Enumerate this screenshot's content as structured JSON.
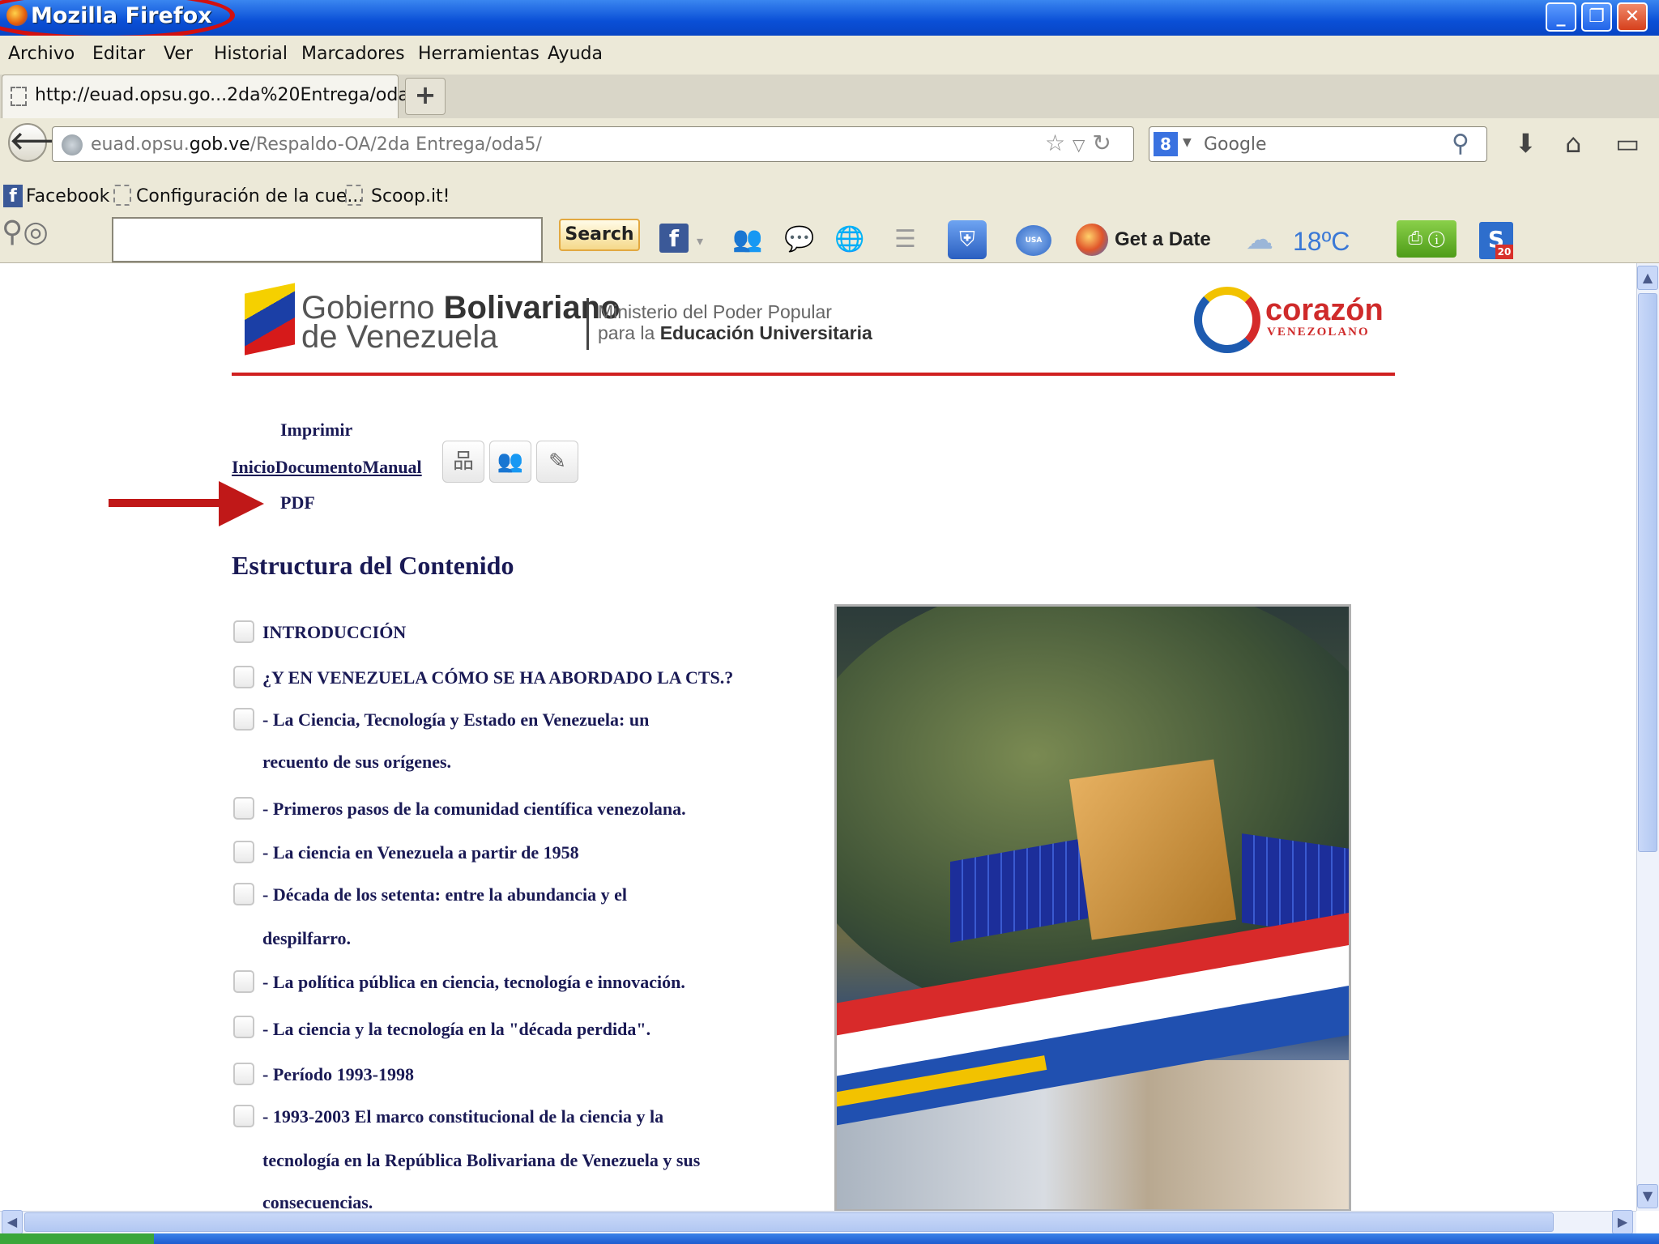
{
  "window": {
    "title": "Mozilla Firefox",
    "controls": {
      "minimize": "_",
      "maximize": "❐",
      "close": "✕"
    }
  },
  "menu": [
    "Archivo",
    "Editar",
    "Ver",
    "Historial",
    "Marcadores",
    "Herramientas",
    "Ayuda"
  ],
  "tab": {
    "label": "http://euad.opsu.go...2da%20Entrega/oda5/",
    "new_tab": "+"
  },
  "navbar": {
    "url_prefix": "euad.opsu.",
    "url_domain": "gob.ve",
    "url_path": "/Respaldo-OA/2da Entrega/oda5/",
    "search_placeholder": "Google",
    "search_engine_icon": "8"
  },
  "bookmarks": [
    "Facebook",
    "Configuración de la cue...",
    "Scoop.it!"
  ],
  "toolbar": {
    "search_button": "Search",
    "get_a_date": "Get a Date",
    "temperature": "18ºC",
    "usa_today": "USA TODAY",
    "badge": "20"
  },
  "header": {
    "gov_line1_a": "Gobierno ",
    "gov_line1_b": "Bolivariano",
    "gov_line2": "de Venezuela",
    "ministry_line1": "Ministerio del Poder Popular",
    "ministry_line2_a": "para la ",
    "ministry_line2_b": "Educación Universitaria",
    "brand_main": "corazón",
    "brand_sub": "VENEZOLANO"
  },
  "nav": {
    "imprimir": "Imprimir",
    "links": "InicioDocumentoManual",
    "pdf": "PDF"
  },
  "content": {
    "heading": "Estructura del Contenido",
    "toc": [
      "INTRODUCCIÓN",
      "¿Y EN VENEZUELA CÓMO SE HA ABORDADO LA CTS.?",
      "- La Ciencia, Tecnología y Estado en Venezuela: un",
      "recuento de sus orígenes.",
      "- Primeros pasos de la comunidad científica venezolana.",
      "- La ciencia en Venezuela a partir de 1958",
      "- Década de los setenta: entre la abundancia y el",
      "despilfarro.",
      "- La política pública en ciencia, tecnología e innovación.",
      "- La ciencia y la tecnología en la \"década perdida\".",
      "- Período 1993-1998",
      "- 1993-2003 El marco constitucional de la ciencia y la",
      "tecnología en la República Bolivariana de Venezuela y sus",
      "consecuencias."
    ]
  },
  "colors": {
    "accent_red": "#d02020",
    "link_navy": "#1a1a55",
    "xp_blue": "#0a4fd6"
  }
}
